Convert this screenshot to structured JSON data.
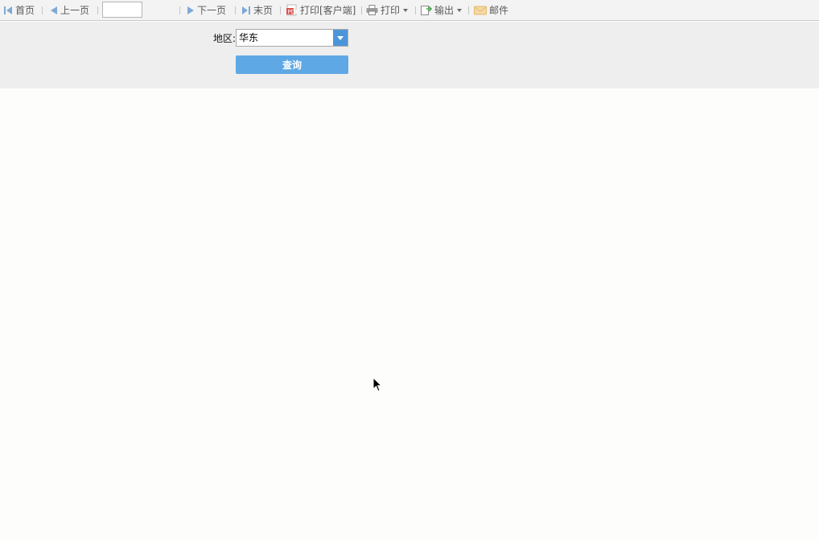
{
  "toolbar": {
    "first_label": "首页",
    "prev_label": "上一页",
    "page_input_value": "",
    "next_label": "下一页",
    "last_label": "末页",
    "print_client_label": "打印[客户端]",
    "print_label": "打印",
    "export_label": "输出",
    "mail_label": "邮件"
  },
  "params": {
    "region_label": "地区:",
    "region_value": "华东",
    "query_label": "查询"
  },
  "colors": {
    "accent": "#5ea8e5",
    "combo_button": "#4d95d9",
    "toolbar_bg": "#f3f3f3",
    "panel_bg": "#eeeeee"
  }
}
